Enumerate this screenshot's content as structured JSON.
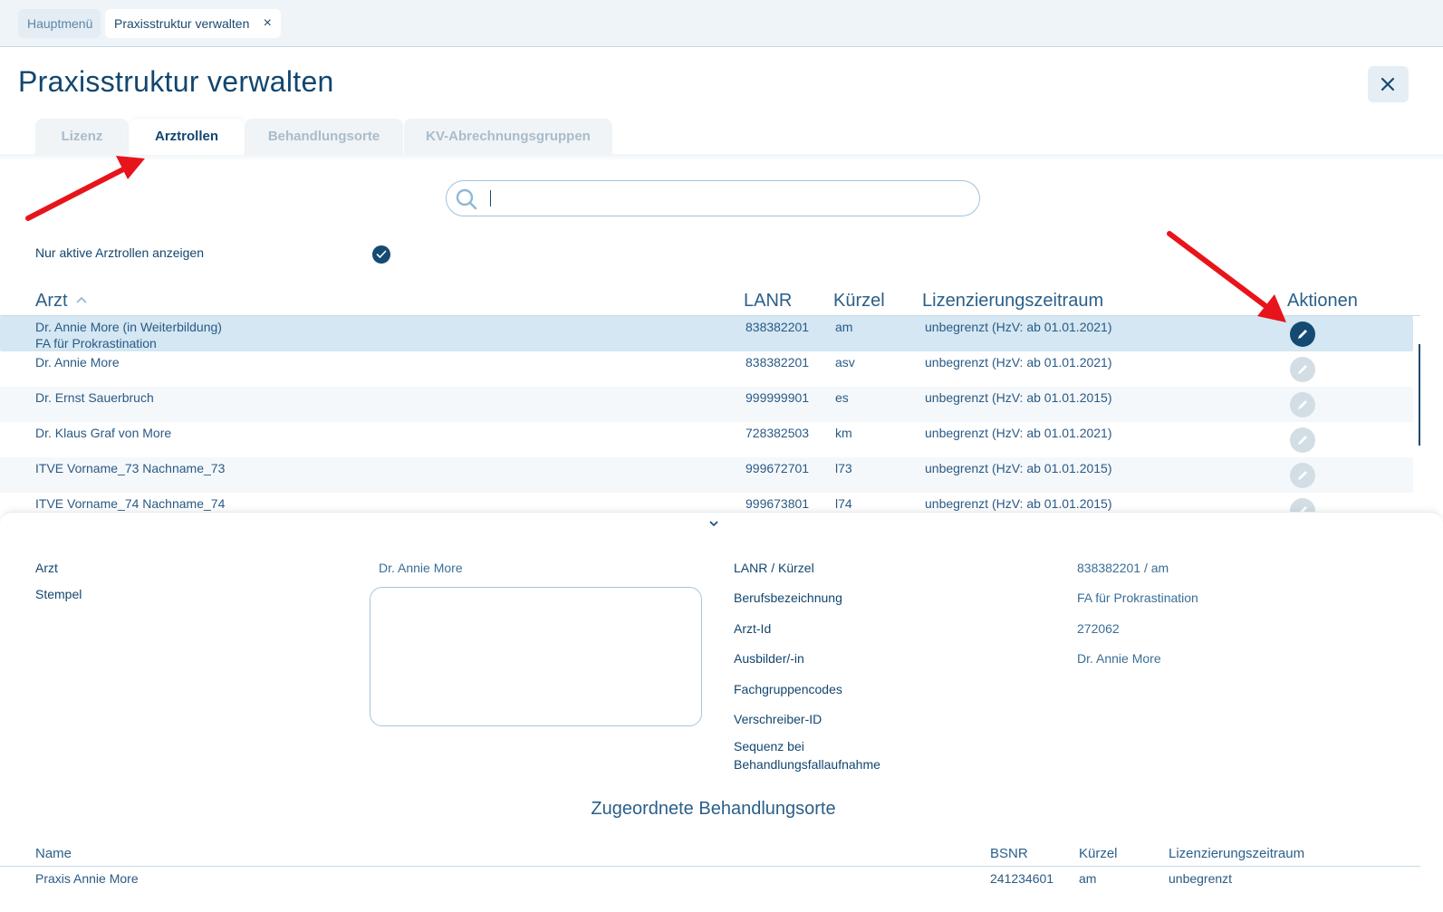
{
  "top_tabs": {
    "home": "Hauptmenü",
    "current": "Praxisstruktur verwalten",
    "close_glyph": "×"
  },
  "page": {
    "title": "Praxisstruktur verwalten"
  },
  "tabs": [
    "Lizenz",
    "Arztrollen",
    "Behandlungsorte",
    "KV-Abrechnungsgruppen"
  ],
  "active_tab": "Arztrollen",
  "search": {
    "value": "",
    "placeholder": ""
  },
  "filter": {
    "label": "Nur aktive Arztrollen anzeigen",
    "checked": true
  },
  "table": {
    "headers": {
      "arzt": "Arzt",
      "lanr": "LANR",
      "kuerzel": "Kürzel",
      "zeitraum": "Lizenzierungszeitraum",
      "aktionen": "Aktionen"
    },
    "sort_glyph": "^",
    "rows": [
      {
        "name": "Dr. Annie More (in Weiterbildung)",
        "sub": "FA für Prokrastination",
        "lanr": "838382201",
        "kuerzel": "am",
        "zeitraum": "unbegrenzt (HzV: ab 01.01.2021)"
      },
      {
        "name": "Dr. Annie More",
        "sub": "",
        "lanr": "838382201",
        "kuerzel": "asv",
        "zeitraum": "unbegrenzt (HzV: ab 01.01.2021)"
      },
      {
        "name": "Dr. Ernst Sauerbruch",
        "sub": "",
        "lanr": "999999901",
        "kuerzel": "es",
        "zeitraum": "unbegrenzt (HzV: ab 01.01.2015)"
      },
      {
        "name": "Dr. Klaus Graf von More",
        "sub": "",
        "lanr": "728382503",
        "kuerzel": "km",
        "zeitraum": "unbegrenzt (HzV: ab 01.01.2021)"
      },
      {
        "name": "ITVE Vorname_73 Nachname_73",
        "sub": "",
        "lanr": "999672701",
        "kuerzel": "l73",
        "zeitraum": "unbegrenzt (HzV: ab 01.01.2015)"
      },
      {
        "name": "ITVE Vorname_74 Nachname_74",
        "sub": "",
        "lanr": "999673801",
        "kuerzel": "l74",
        "zeitraum": "unbegrenzt (HzV: ab 01.01.2015)"
      }
    ]
  },
  "details": {
    "arzt_label": "Arzt",
    "arzt_value": "Dr. Annie More",
    "stempel_label": "Stempel",
    "lanr_label": "LANR / Kürzel",
    "lanr_value": "838382201 / am",
    "beruf_label": "Berufsbezeichnung",
    "beruf_value": "FA für Prokrastination",
    "arztid_label": "Arzt-Id",
    "arztid_value": "272062",
    "ausbilder_label": "Ausbilder/-in",
    "ausbilder_value": "Dr. Annie More",
    "fachgruppe_label": "Fachgruppencodes",
    "verschreiber_label": "Verschreiber-ID",
    "sequenz_label_1": "Sequenz bei",
    "sequenz_label_2": "Behandlungsfallaufnahme"
  },
  "behandlungsorte": {
    "title": "Zugeordnete Behandlungsorte",
    "headers": {
      "name": "Name",
      "bsnr": "BSNR",
      "kuerzel": "Kürzel",
      "zeitraum": "Lizenzierungszeitraum"
    },
    "rows": [
      {
        "name": "Praxis Annie More",
        "bsnr": "241234601",
        "kuerzel": "am",
        "zeitraum": "unbegrenzt"
      }
    ]
  },
  "icons": {
    "search": "search-icon",
    "edit": "pencil-icon",
    "close": "close-icon",
    "check": "check-icon",
    "chevron": "chevron-down-icon",
    "annotation": "red-arrow"
  },
  "colors": {
    "primary": "#154a73",
    "selected_row": "#d4e7f2",
    "annotation": "#e8141b"
  }
}
